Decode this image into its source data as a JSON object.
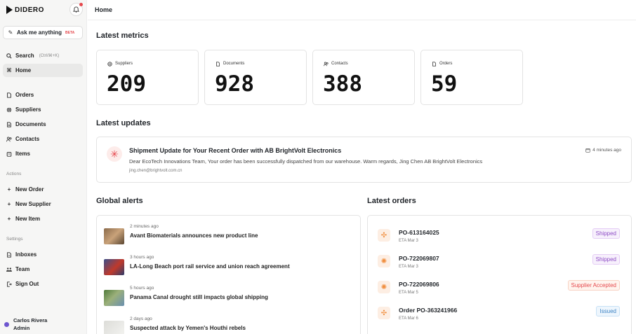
{
  "brand": {
    "name": "DIDERO"
  },
  "sidebar": {
    "ask": {
      "label": "Ask me anything",
      "badge": "BETA"
    },
    "search": {
      "label": "Search",
      "hint": "(Ctrl/⌘+K)"
    },
    "home": {
      "label": "Home"
    },
    "nav": [
      {
        "label": "Orders",
        "icon": "document-icon"
      },
      {
        "label": "Suppliers",
        "icon": "globe-icon"
      },
      {
        "label": "Documents",
        "icon": "document-stack-icon"
      },
      {
        "label": "Contacts",
        "icon": "contacts-icon"
      },
      {
        "label": "Items",
        "icon": "box-icon"
      }
    ],
    "actions_label": "Actions",
    "actions": [
      {
        "label": "New Order"
      },
      {
        "label": "New Supplier"
      },
      {
        "label": "New Item"
      }
    ],
    "settings_label": "Settings",
    "settings": [
      {
        "label": "Inboxes"
      },
      {
        "label": "Team"
      },
      {
        "label": "Sign Out"
      }
    ],
    "user": {
      "name": "Carlos Rivera",
      "role": "Admin"
    }
  },
  "header": {
    "title": "Home"
  },
  "metrics": {
    "title": "Latest metrics",
    "items": [
      {
        "label": "Suppliers",
        "value": "209"
      },
      {
        "label": "Documents",
        "value": "928"
      },
      {
        "label": "Contacts",
        "value": "388"
      },
      {
        "label": "Orders",
        "value": "59"
      }
    ]
  },
  "updates": {
    "title": "Latest updates",
    "item": {
      "title": "Shipment Update for Your Recent Order with AB BrightVolt Electronics",
      "body": "Dear EcoTech Innovations Team, Your order has been successfully dispatched from our warehouse. Warm regards, Jing Chen AB BrightVolt Electronics",
      "email": "jing.chen@brightvolt.com.cn",
      "time": "4 minutes ago"
    }
  },
  "alerts": {
    "title": "Global alerts",
    "items": [
      {
        "time": "2 minutes ago",
        "title": "Avant Biomaterials announces new product line"
      },
      {
        "time": "3 hours ago",
        "title": "LA-Long Beach port rail service and union reach agreement"
      },
      {
        "time": "5 hours ago",
        "title": "Panama Canal drought still impacts global shipping"
      },
      {
        "time": "2 days ago",
        "title": "Suspected attack by Yemen's Houthi rebels"
      }
    ]
  },
  "orders": {
    "title": "Latest orders",
    "items": [
      {
        "id": "PO-613164025",
        "eta": "ETA Mar 3",
        "status": "Shipped"
      },
      {
        "id": "PO-722069807",
        "eta": "ETA Mar 3",
        "status": "Shipped"
      },
      {
        "id": "PO-722069806",
        "eta": "ETA Mar 5",
        "status": "Supplier Accepted"
      },
      {
        "id": "Order PO-363241966",
        "eta": "ETA Mar 6",
        "status": "Issued"
      }
    ]
  },
  "colors": {
    "accent_red": "#e5484d",
    "shipped": "#8e4ec6",
    "accepted": "#e5484d",
    "issued": "#3b82c4",
    "order_icon": "#f08c3a"
  }
}
